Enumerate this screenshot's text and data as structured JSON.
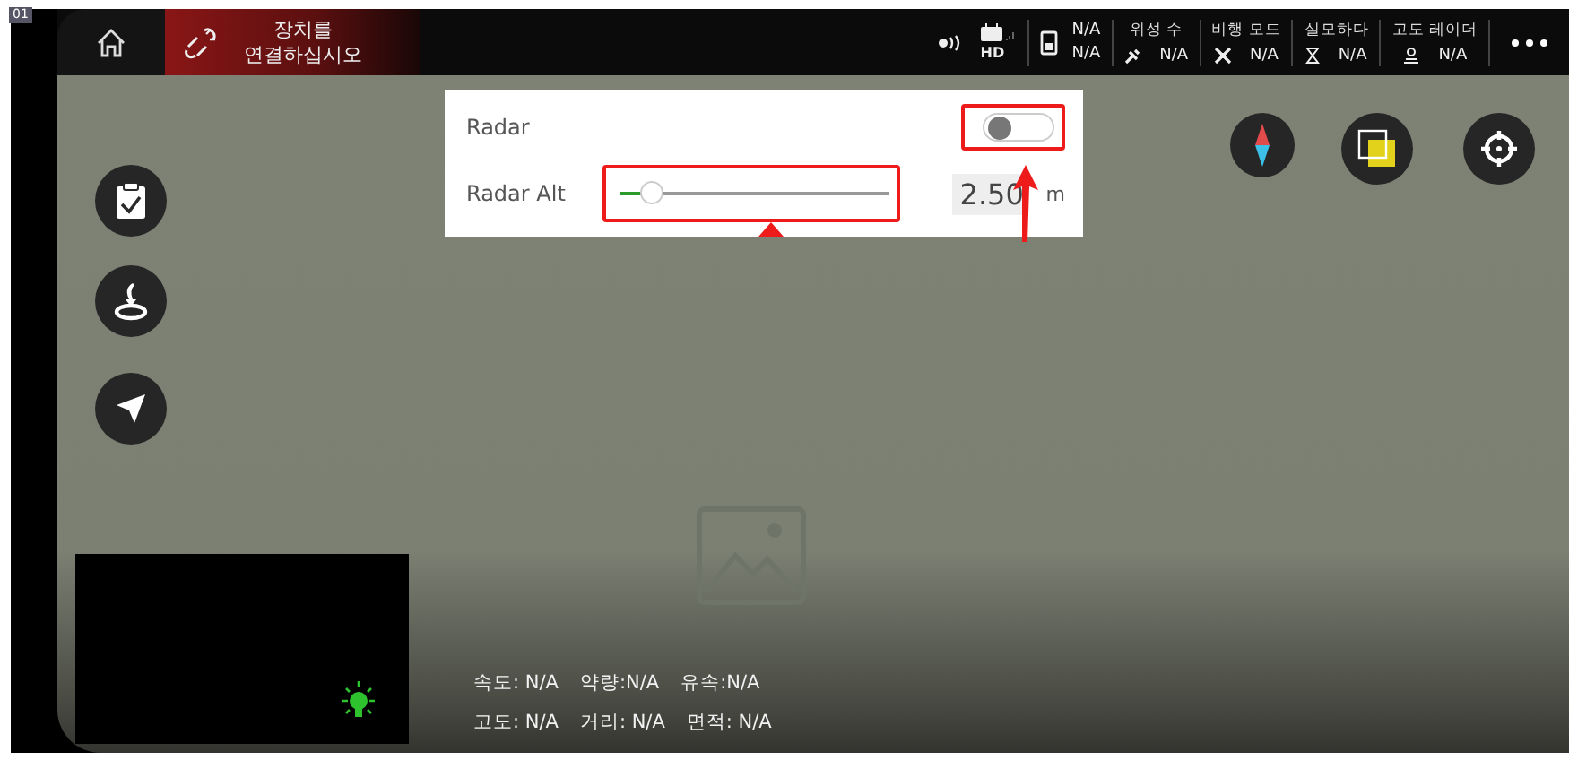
{
  "corner_tag": "01",
  "top_bar": {
    "title_lines": [
      "장치를",
      "연결하십시오"
    ],
    "indicators": [
      {
        "kind": "rc",
        "value2": "HD"
      },
      {
        "kind": "battery",
        "value1": "N/A",
        "value2": "N/A"
      },
      {
        "kind": "satellite",
        "label": "위성 수",
        "value": "N/A"
      },
      {
        "kind": "flight-mode",
        "label": "비행 모드",
        "value": "N/A"
      },
      {
        "kind": "hourglass",
        "label": "실모하다",
        "value": "N/A"
      },
      {
        "kind": "altitude",
        "label": "고도 레이더",
        "value": "N/A"
      }
    ]
  },
  "radar": {
    "label": "Radar",
    "on": false
  },
  "radar_alt": {
    "label": "Radar Alt",
    "level": 0.12,
    "value": "2.50",
    "unit": "m"
  },
  "stats": [
    {
      "items": [
        "속도: N/A",
        "약량:N/A",
        "유속:N/A"
      ]
    },
    {
      "items": [
        "고도: N/A",
        "거리: N/A",
        "면적: N/A"
      ]
    }
  ]
}
